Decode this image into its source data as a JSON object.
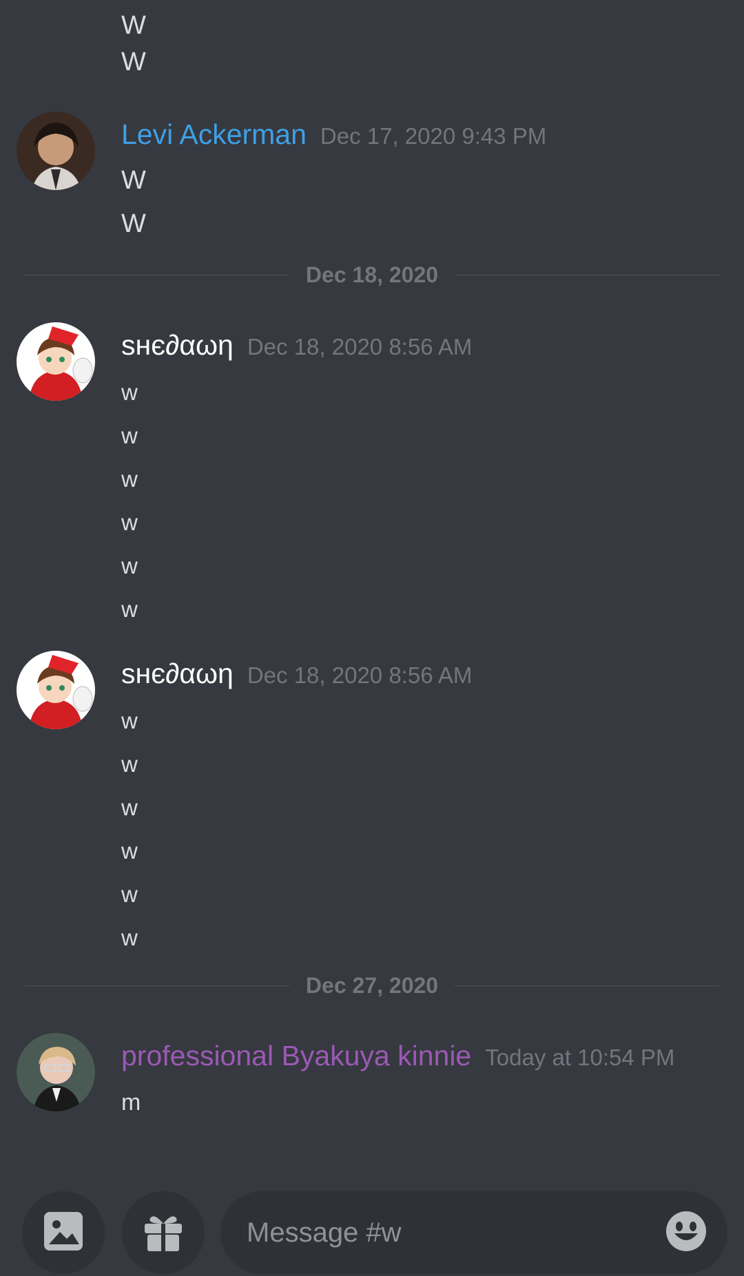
{
  "top_fragment": {
    "lines": [
      "W",
      "W"
    ]
  },
  "messages": [
    {
      "author": "Levi Ackerman",
      "author_color": "#3ea0e6",
      "timestamp": "Dec 17, 2020 9:43 PM",
      "avatar": "avatar-levi",
      "lines": [
        "W",
        "W"
      ]
    },
    {
      "author": "ѕнє∂αωη",
      "author_color": "#ffffff",
      "timestamp": "Dec 18, 2020 8:56 AM",
      "avatar": "avatar-shedawn",
      "lines": [
        "w",
        "w",
        "w",
        "w",
        "w",
        "w"
      ]
    },
    {
      "author": "ѕнє∂αωη",
      "author_color": "#ffffff",
      "timestamp": "Dec 18, 2020 8:56 AM",
      "avatar": "avatar-shedawn",
      "lines": [
        "w",
        "w",
        "w",
        "w",
        "w",
        "w"
      ]
    },
    {
      "author": "professional Byakuya kinnie",
      "author_color": "#9b59b6",
      "timestamp": "Today at 10:54 PM",
      "avatar": "avatar-byakuya",
      "lines": [
        "m"
      ]
    }
  ],
  "dividers": [
    "Dec 18, 2020",
    "Dec 27, 2020"
  ],
  "composer": {
    "placeholder": "Message #w",
    "image_icon": "image-icon",
    "gift_icon": "gift-icon",
    "emoji_icon": "emoji-icon"
  },
  "colors": {
    "background": "#36393f",
    "input_background": "#2f3136",
    "muted_text": "#72767d"
  }
}
